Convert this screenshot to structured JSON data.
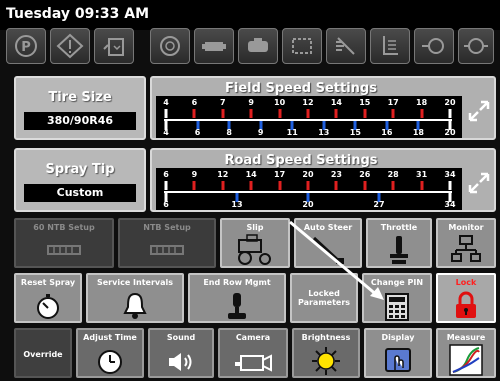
{
  "header": {
    "clock": "Tuesday 09:33 AM"
  },
  "warning_icons": [
    "parking-brake-icon",
    "warning-diamond-icon",
    "tank-low-icon",
    "engine-icon",
    "hydraulic-icon",
    "engine-2-icon",
    "filter-icon",
    "spray-off-icon",
    "level-icon",
    "pump-icon",
    "boom-icon"
  ],
  "tire": {
    "label": "Tire Size",
    "value": "380/90R46"
  },
  "spraytip": {
    "label": "Spray Tip",
    "value": "Custom"
  },
  "field_speed": {
    "title": "Field Speed Settings",
    "top_ticks": [
      "4",
      "6",
      "7",
      "9",
      "10",
      "12",
      "14",
      "15",
      "17",
      "18",
      "20"
    ],
    "bottom_ticks": [
      "4",
      "6",
      "8",
      "9",
      "11",
      "13",
      "15",
      "16",
      "18",
      "20"
    ]
  },
  "road_speed": {
    "title": "Road Speed Settings",
    "top_ticks": [
      "6",
      "9",
      "12",
      "14",
      "17",
      "20",
      "23",
      "26",
      "28",
      "31",
      "34"
    ],
    "bottom_ticks": [
      "6",
      "13",
      "20",
      "27",
      "34"
    ]
  },
  "grid": {
    "r1": [
      "60 NTB Setup",
      "NTB Setup",
      "Slip",
      "Auto Steer",
      "Throttle",
      "Monitor"
    ],
    "r2": [
      "Reset Spray",
      "Service Intervals",
      "End Row Mgmt",
      "Locked Parameters",
      "Change PIN",
      "Lock"
    ],
    "r3": [
      "Override",
      "Adjust Time",
      "Sound",
      "Camera",
      "Brightness",
      "Display",
      "Measure"
    ]
  },
  "colors": {
    "lock_label": "#ff2020",
    "lock_icon": "#e01010",
    "tick_red": "#e02020",
    "tick_blue": "#2060e0"
  }
}
